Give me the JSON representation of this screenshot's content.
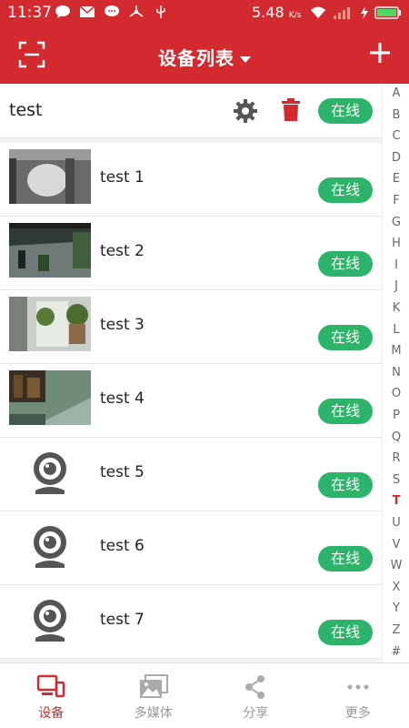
{
  "status": {
    "time": "11:37",
    "speed": "5.48",
    "speed_unit": "K/s"
  },
  "header": {
    "title": "设备列表",
    "icons": [
      "scan-icon",
      "dropdown-caret-icon",
      "plus-icon"
    ]
  },
  "group": {
    "name": "test",
    "status": "在线",
    "icons": [
      "gear-icon",
      "trash-icon"
    ]
  },
  "devices": [
    {
      "name": "test 1",
      "status": "在线",
      "thumb": "camera-snapshot-dark"
    },
    {
      "name": "test 2",
      "status": "在线",
      "thumb": "camera-snapshot-night-yard"
    },
    {
      "name": "test 3",
      "status": "在线",
      "thumb": "camera-snapshot-plants"
    },
    {
      "name": "test 4",
      "status": "在线",
      "thumb": "camera-snapshot-room"
    },
    {
      "name": "test 5",
      "status": "在线",
      "thumb": "webcam-icon"
    },
    {
      "name": "test 6",
      "status": "在线",
      "thumb": "webcam-icon"
    },
    {
      "name": "test 7",
      "status": "在线",
      "thumb": "webcam-icon"
    }
  ],
  "alphabet": [
    "A",
    "B",
    "C",
    "D",
    "E",
    "F",
    "G",
    "H",
    "I",
    "J",
    "K",
    "L",
    "M",
    "N",
    "O",
    "P",
    "Q",
    "R",
    "S",
    "T",
    "U",
    "V",
    "W",
    "X",
    "Y",
    "Z",
    "#"
  ],
  "alphabet_active": "T",
  "nav": {
    "tabs": [
      {
        "label": "设备",
        "icon": "devices-icon",
        "active": true
      },
      {
        "label": "多媒体",
        "icon": "gallery-icon",
        "active": false
      },
      {
        "label": "分享",
        "icon": "share-icon",
        "active": false
      },
      {
        "label": "更多",
        "icon": "more-icon",
        "active": false
      }
    ]
  },
  "colors": {
    "brand_red": "#d32a2f",
    "online_green": "#2db36a"
  }
}
